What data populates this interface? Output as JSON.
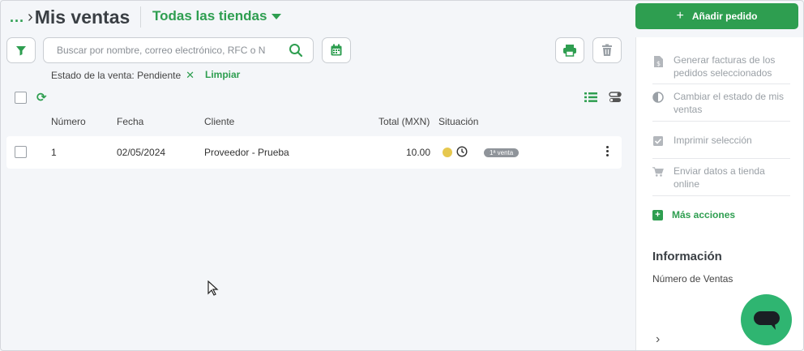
{
  "header": {
    "breadcrumb_dots": "...",
    "title": "Mis ventas",
    "store_select": "Todas las tiendas",
    "add_button": "Añadir pedido"
  },
  "toolbar": {
    "search_placeholder": "Buscar por nombre, correo electrónico, RFC o N"
  },
  "filters": {
    "active": "Estado de la venta: Pendiente",
    "clear": "Limpiar"
  },
  "table": {
    "columns": [
      "Número",
      "Fecha",
      "Cliente",
      "Total (MXN)",
      "Situación"
    ],
    "rows": [
      {
        "number": "1",
        "date": "02/05/2024",
        "client": "Proveedor - Prueba",
        "total": "10.00",
        "status_badge": "1ª venta"
      }
    ]
  },
  "side_panel": {
    "actions": [
      {
        "icon": "invoice-icon",
        "label": "Generar facturas de los pedidos seleccionados"
      },
      {
        "icon": "contrast-icon",
        "label": "Cambiar el estado de mis ventas"
      },
      {
        "icon": "checkbox-icon",
        "label": "Imprimir selección"
      },
      {
        "icon": "cart-icon",
        "label": "Enviar datos a tienda online"
      }
    ],
    "more_actions": "Más acciones",
    "info_title": "Información",
    "info_subtitle": "Número de Ventas"
  },
  "colors": {
    "accent": "#2e9e50",
    "status_dot": "#e6c84f",
    "chat": "#2fb571"
  }
}
